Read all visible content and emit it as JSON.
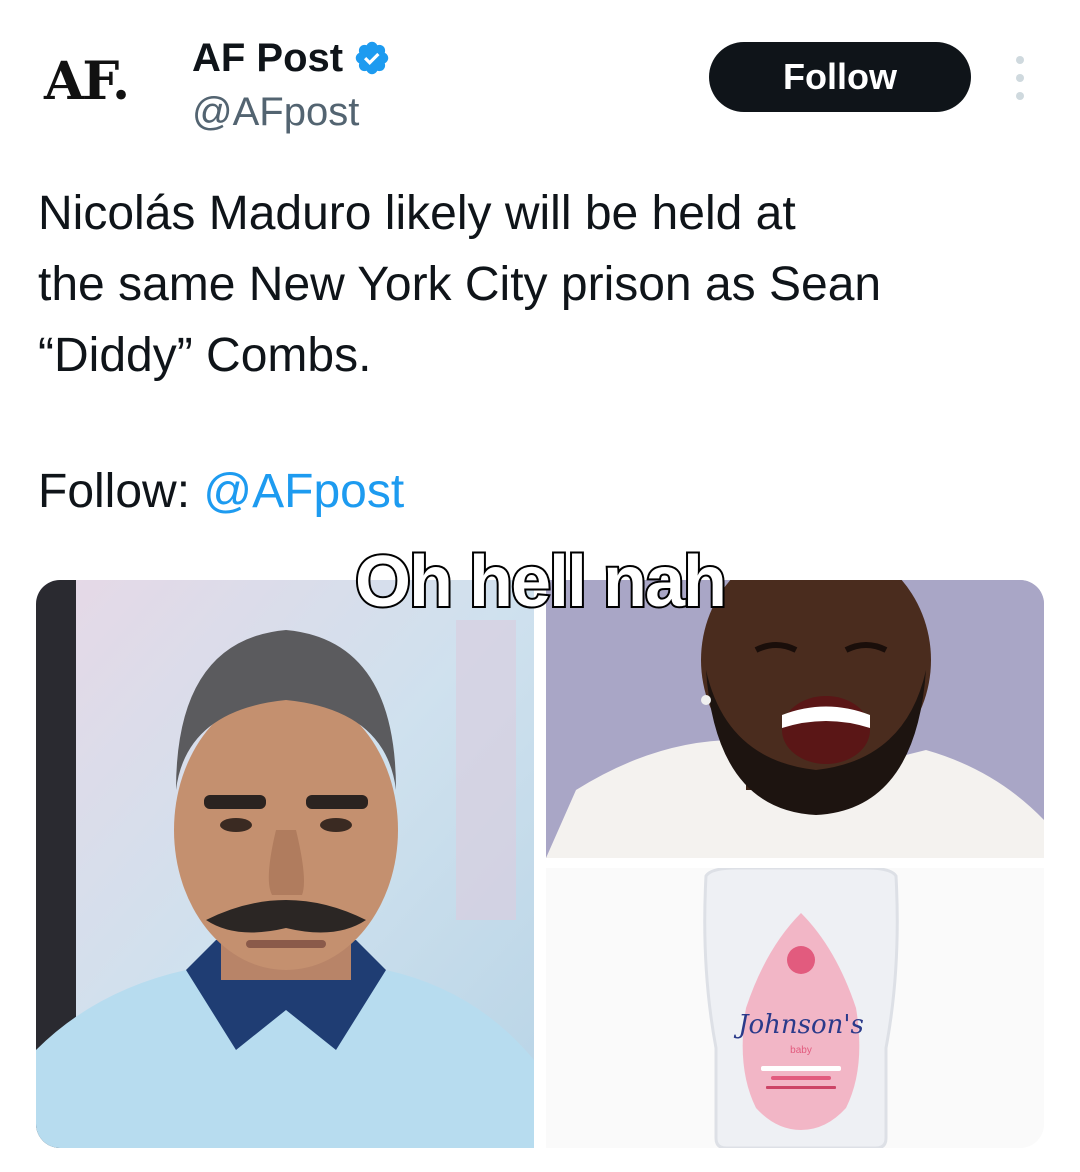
{
  "author": {
    "logo_text": "AF.",
    "display_name": "AF Post",
    "handle": "@AFpost",
    "verified_icon": "verified-badge-icon"
  },
  "header": {
    "follow_label": "Follow",
    "more_icon": "more-options-icon"
  },
  "tweet": {
    "text_lines": [
      "Nicolás Maduro likely will be held at",
      "the same New York City prison as Sean",
      "“Diddy” Combs."
    ],
    "follow_prefix": "Follow: ",
    "follow_mention": "@AFpost"
  },
  "media": {
    "bottle_brand": "Johnson's",
    "bottle_sub": "baby"
  },
  "overlay": {
    "caption": "Oh hell nah"
  },
  "colors": {
    "accent": "#1d9bf0",
    "text": "#0f1419",
    "muted": "#536471",
    "follow_button_bg": "#0f1419"
  }
}
